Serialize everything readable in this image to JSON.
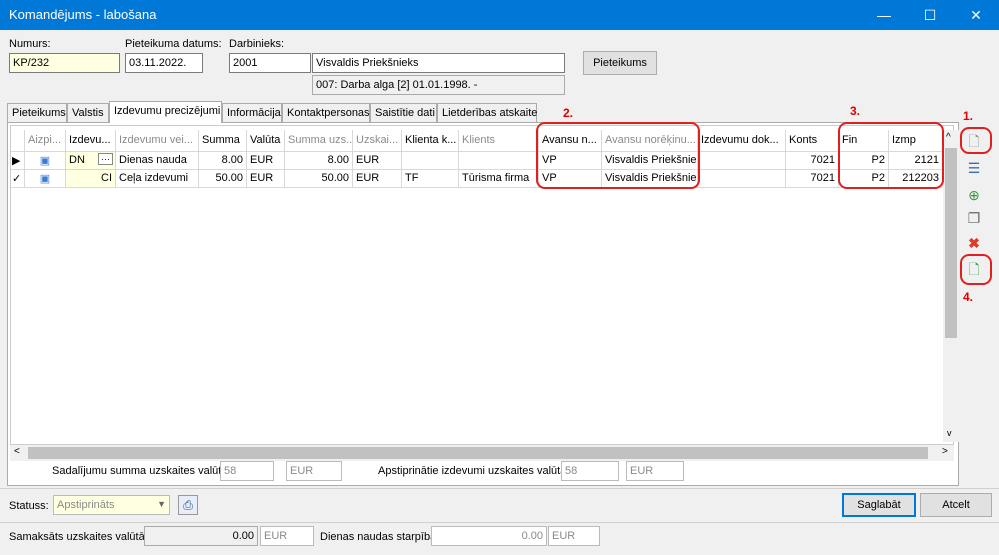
{
  "window": {
    "title": "Komandējums - labošana",
    "minimize": "—",
    "maximize": "☐",
    "close": "✕"
  },
  "header": {
    "number_label": "Numurs:",
    "number_value": "KP/232",
    "date_label": "Pieteikuma datums:",
    "date_value": "03.11.2022.",
    "employee_label": "Darbinieks:",
    "employee_code": "2001",
    "employee_name": "Visvaldis Priekšnieks",
    "employment_info": "007: Darba alga [2] 01.01.1998. -",
    "application_button": "Pieteikums"
  },
  "tabs": [
    {
      "label": "Pieteikums"
    },
    {
      "label": "Valstis"
    },
    {
      "label": "Izdevumu precizējumi"
    },
    {
      "label": "Informācija"
    },
    {
      "label": "Kontaktpersonas"
    },
    {
      "label": "Saistītie dati"
    },
    {
      "label": "Lietderības atskaite"
    }
  ],
  "table": {
    "columns": [
      "Aizpi...",
      "Izdevu...",
      "Izdevumu vei...",
      "Summa",
      "Valūta",
      "Summa uzs...",
      "Uzskai...",
      "Klienta k...",
      "Klients",
      "Avansu n...",
      "Avansu norēķinu...",
      "Izdevumu dok...",
      "Konts",
      "Fin",
      "Izmp"
    ],
    "rows": [
      {
        "marker": "▶",
        "code": "DN",
        "ellipsis": "···",
        "type": "Dienas nauda",
        "sum": "8.00",
        "currency": "EUR",
        "sum_acc": "8.00",
        "acc_currency": "EUR",
        "client_code": "",
        "client": "",
        "adv_code": "VP",
        "adv_name": "Visvaldis Priekšnieks",
        "doc": "",
        "account": "7021",
        "fin": "P2",
        "izmp": "2121"
      },
      {
        "marker": "✓",
        "code": "CI",
        "ellipsis": "",
        "type": "Ceļa izdevumi",
        "sum": "50.00",
        "currency": "EUR",
        "sum_acc": "50.00",
        "acc_currency": "EUR",
        "client_code": "TF",
        "client": "Tūrisma firma",
        "adv_code": "VP",
        "adv_name": "Visvaldis Priekšnieks",
        "doc": "",
        "account": "7021",
        "fin": "P2",
        "izmp": "212203"
      }
    ]
  },
  "totals": {
    "split_label": "Sadalījumu summa uzskaites valūtā:",
    "split_value": "58",
    "split_currency": "EUR",
    "approved_label": "Apstiprinātie izdevumi uzskaites valūtā:",
    "approved_value": "58",
    "approved_currency": "EUR"
  },
  "status": {
    "label": "Statuss:",
    "value": "Apstiprināts"
  },
  "buttons": {
    "save": "Saglabāt",
    "cancel": "Atcelt"
  },
  "footer": {
    "paid_label": "Samaksāts uzskaites valūtā:",
    "paid_value": "0.00",
    "paid_currency": "EUR",
    "diff_label": "Dienas naudas starpība:",
    "diff_value": "0.00",
    "diff_currency": "EUR"
  },
  "annotations": {
    "a1": "1.",
    "a2": "2.",
    "a3": "3.",
    "a4": "4."
  },
  "colors": {
    "titlebar": "#0078d7",
    "highlight": "#e02020",
    "yellow_field": "#ffffe1"
  }
}
